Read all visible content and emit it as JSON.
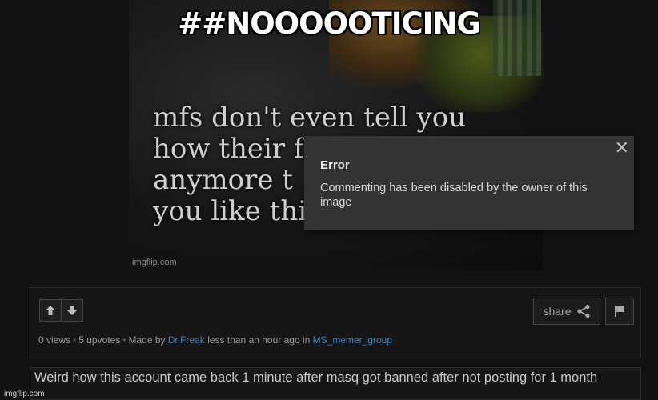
{
  "meme": {
    "top_text": "##NOOOOOTICING",
    "caption_lines": [
      "mfs don't even tell you",
      "how their f",
      "anymore t",
      "you like this when you ask"
    ],
    "watermark": "imgflip.com"
  },
  "error_popup": {
    "close_glyph": "✕",
    "title": "Error",
    "message": "Commenting has been disabled by the owner of this image"
  },
  "post_panel": {
    "share_label": "share",
    "views": "0 views",
    "upvotes": "5 upvotes",
    "made_by_label": "Made by",
    "author": "Dr.Freak",
    "time_text": "less than an hour ago in",
    "stream": "MS_memer_group"
  },
  "comment": {
    "text": "Weird how this account came back 1 minute after masq got banned after not posting for 1 month"
  },
  "site_watermark": "imgflip.com",
  "colors": {
    "link": "#3b82c4",
    "background": "#121212",
    "popup": "#333333"
  },
  "icons": [
    "arrow-up-icon",
    "arrow-down-icon",
    "share-icon",
    "flag-icon",
    "close-icon"
  ]
}
